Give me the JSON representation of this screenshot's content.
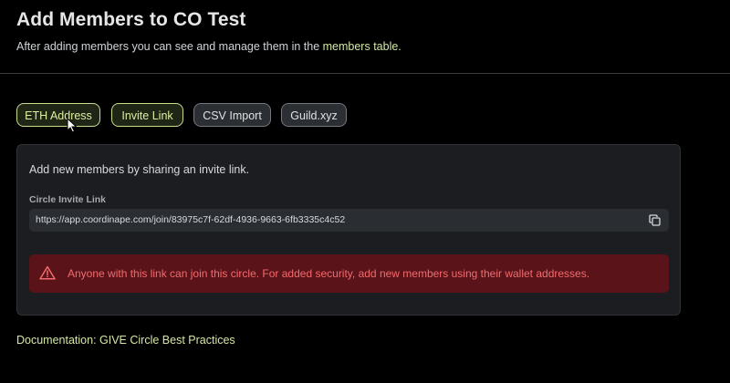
{
  "header": {
    "title": "Add Members to CO Test",
    "subtitle_prefix": "After adding members you can see and manage them in the ",
    "subtitle_link": "members table."
  },
  "tabs": [
    {
      "label": "ETH Address",
      "selected": true
    },
    {
      "label": "Invite Link",
      "selected": true
    },
    {
      "label": "CSV Import",
      "selected": false
    },
    {
      "label": "Guild.xyz",
      "selected": false
    }
  ],
  "panel": {
    "description": "Add new members by sharing an invite link.",
    "field_label": "Circle Invite Link",
    "invite_url": "https://app.coordinape.com/join/83975c7f-62df-4936-9663-6fb3335c4c52",
    "alert_text": "Anyone with this link can join this circle. For added security, add new members using their wallet addresses."
  },
  "footer": {
    "docs_link": "Documentation: GIVE Circle Best Practices"
  },
  "icons": {
    "copy": "copy-icon",
    "warning": "warning-icon",
    "cursor": "mouse-pointer-icon"
  },
  "colors": {
    "accent": "#d3e8a4",
    "alert_bg": "#5a1318",
    "alert_text": "#f26b6f",
    "background": "#000000",
    "panel_bg": "#1b1d21"
  }
}
